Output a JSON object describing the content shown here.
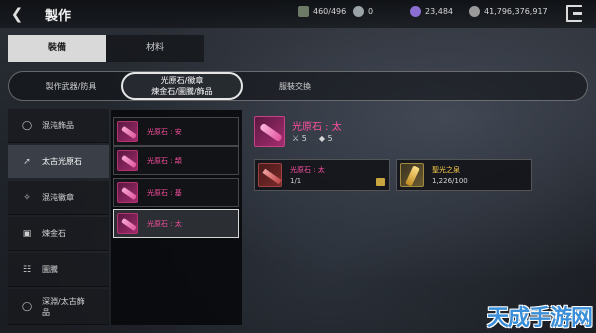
{
  "header": {
    "back_icon": "chevron-left-icon",
    "title": "製作",
    "resources": [
      {
        "icon": "bag-icon",
        "value": "460/496"
      },
      {
        "icon": "gold-icon",
        "value": "0"
      },
      {
        "icon": "gem-icon",
        "value": "23,484"
      },
      {
        "icon": "coin-icon",
        "value": "41,796,376,917"
      }
    ],
    "exit_icon": "exit-icon"
  },
  "main_tabs": [
    {
      "label": "裝備",
      "active": true
    },
    {
      "label": "材料",
      "active": false
    }
  ],
  "sub_tabs": [
    {
      "line1": "製作武器/防具",
      "line2": "",
      "active": false
    },
    {
      "line1": "光原石/徽章",
      "line2": "煉金石/圖騰/飾品",
      "active": true
    },
    {
      "line1": "服裝交換",
      "line2": "",
      "active": false
    }
  ],
  "categories": [
    {
      "icon": "ring-icon",
      "line1": "混沌飾品",
      "line2": "",
      "active": false
    },
    {
      "icon": "feather-icon",
      "line1": "太古光原石",
      "line2": "",
      "active": true
    },
    {
      "icon": "emblem-icon",
      "line1": "混沌徽章",
      "line2": "",
      "active": false
    },
    {
      "icon": "stone-icon",
      "line1": "煉金石",
      "line2": "",
      "active": false
    },
    {
      "icon": "totem-icon",
      "line1": "圖騰",
      "line2": "",
      "active": false
    },
    {
      "icon": "ring-icon",
      "line1": "深淵/太古飾",
      "line2": "品",
      "active": false
    }
  ],
  "items": [
    {
      "label": "光原石 : 安",
      "active": false
    },
    {
      "label": "光原石 : 頡",
      "active": false
    },
    {
      "label": "光原石 : 基",
      "active": false
    },
    {
      "label": "光原石 : 太",
      "active": true
    }
  ],
  "detail": {
    "name": "光原石 : 太",
    "stat_attack": "5",
    "stat_defense": "5",
    "materials": [
      {
        "name": "光原石 : 太",
        "count": "1/1",
        "color": "#ff4fa0"
      },
      {
        "name": "聖光之泉",
        "count": "1,226/100",
        "color": "#ffcf4a"
      }
    ]
  },
  "watermark": "天成手游网",
  "colors": {
    "accent_pink": "#ff4fa0",
    "accent_gold": "#ffcf4a"
  }
}
